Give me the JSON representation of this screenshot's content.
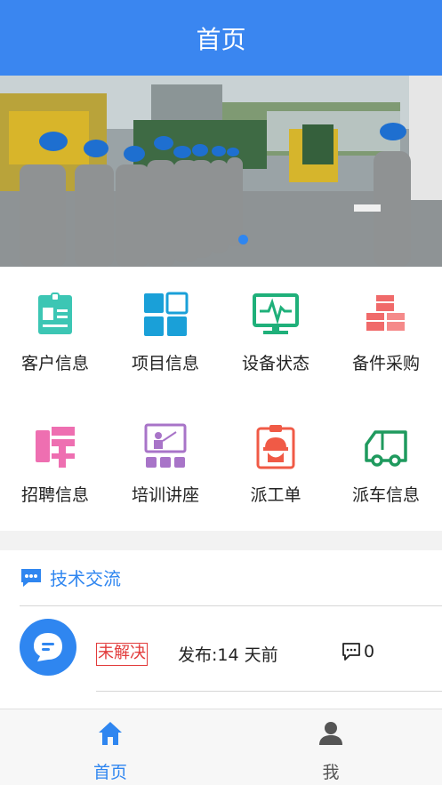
{
  "header": {
    "title": "首页"
  },
  "banner": {
    "slides": 1,
    "active_slide": 1
  },
  "grid": {
    "items": [
      {
        "label": "客户信息",
        "icon": "customer-card-icon",
        "color": "#3cc6b4"
      },
      {
        "label": "项目信息",
        "icon": "project-grid-icon",
        "color": "#1aa0d8"
      },
      {
        "label": "设备状态",
        "icon": "monitor-pulse-icon",
        "color": "#1fb07a"
      },
      {
        "label": "备件采购",
        "icon": "boxes-icon",
        "color": "#f06a6a"
      },
      {
        "label": "招聘信息",
        "icon": "recruit-icon",
        "color": "#ee6fb1"
      },
      {
        "label": "培训讲座",
        "icon": "training-board-icon",
        "color": "#a874c8"
      },
      {
        "label": "派工单",
        "icon": "worker-clipboard-icon",
        "color": "#f05a46"
      },
      {
        "label": "派车信息",
        "icon": "truck-icon",
        "color": "#1f9a5e"
      }
    ]
  },
  "tech": {
    "title": "技术交流",
    "posts": [
      {
        "status": "未解决",
        "published": "发布:14 天前",
        "comments": "0"
      }
    ]
  },
  "tabbar": {
    "tabs": [
      {
        "label": "首页",
        "active": true
      },
      {
        "label": "我",
        "active": false
      }
    ],
    "active_color": "#2f86f0",
    "inactive_color": "#555555"
  }
}
